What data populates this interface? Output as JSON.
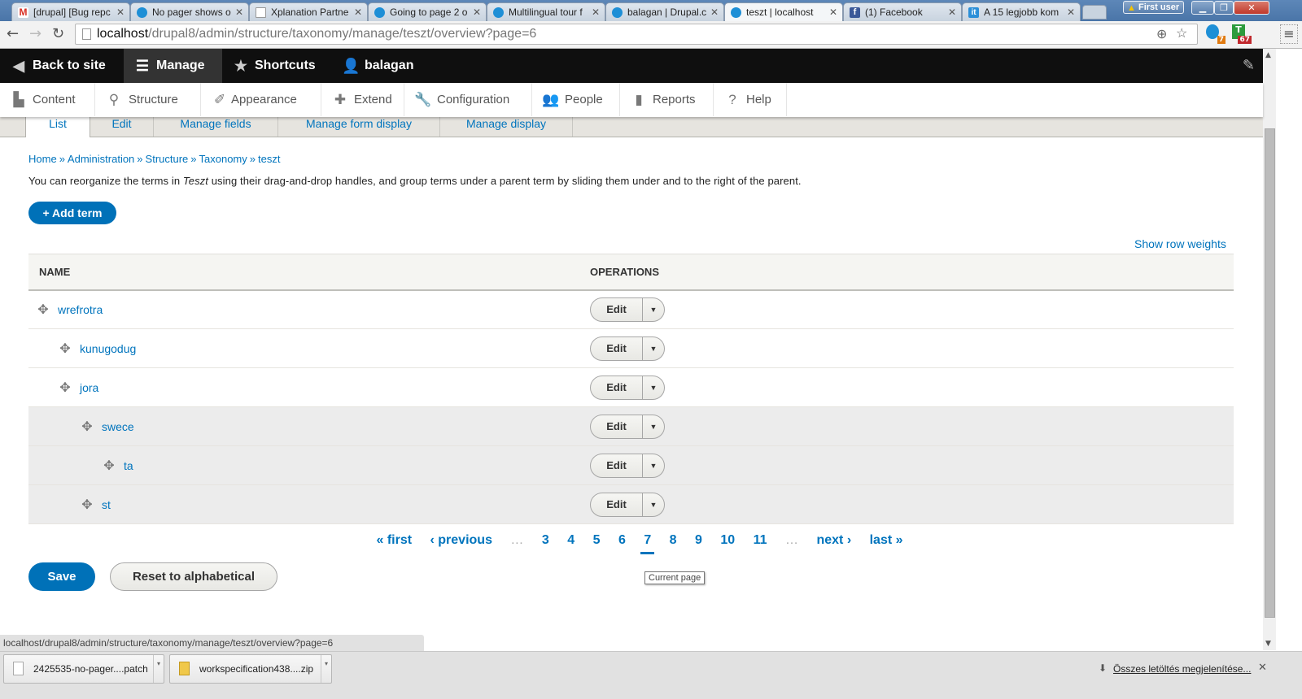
{
  "browser": {
    "tabs": [
      {
        "label": "[drupal] [Bug repc",
        "icon": "gmail-icon"
      },
      {
        "label": "No pager shows o",
        "icon": "drupal-icon"
      },
      {
        "label": "Xplanation Partne",
        "icon": "document-icon"
      },
      {
        "label": "Going to page 2 o",
        "icon": "drupal-icon"
      },
      {
        "label": "Multilingual tour f",
        "icon": "drupal-icon"
      },
      {
        "label": "balagan | Drupal.c",
        "icon": "drupal-icon"
      },
      {
        "label": "teszt | localhost",
        "icon": "drupal-icon",
        "active": true
      },
      {
        "label": "(1) Facebook",
        "icon": "facebook-icon"
      },
      {
        "label": "A 15 legjobb kom",
        "icon": "it-icon"
      }
    ],
    "profile_label": "First user",
    "address": {
      "host": "localhost",
      "path": "/drupal8/admin/structure/taxonomy/manage/teszt/overview?page=6"
    },
    "extensions": [
      {
        "name": "drupal-extension",
        "badge": "7",
        "badge_color": "#e07a10"
      },
      {
        "name": "t-extension",
        "badge": "67",
        "badge_color": "#c0282d"
      }
    ],
    "status_url": "localhost/drupal8/admin/structure/taxonomy/manage/teszt/overview?page=6",
    "downloads": [
      {
        "filename": "2425535-no-pager....patch",
        "type": "patch"
      },
      {
        "filename": "workspecification438....zip",
        "type": "zip"
      }
    ],
    "show_all_downloads": "Összes letöltés megjelenítése..."
  },
  "toolbar": {
    "back_to_site": "Back to site",
    "manage": "Manage",
    "shortcuts": "Shortcuts",
    "user": "balagan"
  },
  "tray": {
    "items": [
      {
        "label": "Content",
        "icon": "content-icon"
      },
      {
        "label": "Structure",
        "icon": "structure-icon"
      },
      {
        "label": "Appearance",
        "icon": "appearance-icon"
      },
      {
        "label": "Extend",
        "icon": "extend-icon"
      },
      {
        "label": "Configuration",
        "icon": "configuration-icon"
      },
      {
        "label": "People",
        "icon": "people-icon"
      },
      {
        "label": "Reports",
        "icon": "reports-icon"
      },
      {
        "label": "Help",
        "icon": "help-icon"
      }
    ]
  },
  "tabs": [
    {
      "label": "List",
      "active": true
    },
    {
      "label": "Edit"
    },
    {
      "label": "Manage fields"
    },
    {
      "label": "Manage form display"
    },
    {
      "label": "Manage display"
    }
  ],
  "breadcrumb": [
    "Home",
    "Administration",
    "Structure",
    "Taxonomy",
    "teszt"
  ],
  "help": {
    "before": "You can reorganize the terms in ",
    "vocab": "Teszt",
    "after": " using their drag-and-drop handles, and group terms under a parent term by sliding them under and to the right of the parent."
  },
  "add_term": "+ Add term",
  "show_row_weights": "Show row weights",
  "table": {
    "headers": [
      "Name",
      "Operations"
    ],
    "rows": [
      {
        "name": "wrefrotra",
        "depth": 0,
        "changed": false,
        "op": "Edit"
      },
      {
        "name": "kunugodug",
        "depth": 1,
        "changed": false,
        "op": "Edit"
      },
      {
        "name": "jora",
        "depth": 1,
        "changed": false,
        "op": "Edit"
      },
      {
        "name": "swece",
        "depth": 2,
        "changed": true,
        "op": "Edit"
      },
      {
        "name": "ta",
        "depth": 3,
        "changed": true,
        "op": "Edit"
      },
      {
        "name": "st",
        "depth": 2,
        "changed": true,
        "op": "Edit"
      }
    ]
  },
  "pager": {
    "first": "« first",
    "previous": "‹ previous",
    "ellipsis": "…",
    "pages": [
      "3",
      "4",
      "5",
      "6",
      "7",
      "8",
      "9",
      "10",
      "11"
    ],
    "current": "7",
    "next": "next ›",
    "last": "last »",
    "current_tooltip": "Current page"
  },
  "actions": {
    "save": "Save",
    "reset": "Reset to alphabetical"
  },
  "colors": {
    "accent": "#0074bd",
    "primary_button": "#0071b8",
    "toolbar_bg": "#0f0f0f"
  }
}
